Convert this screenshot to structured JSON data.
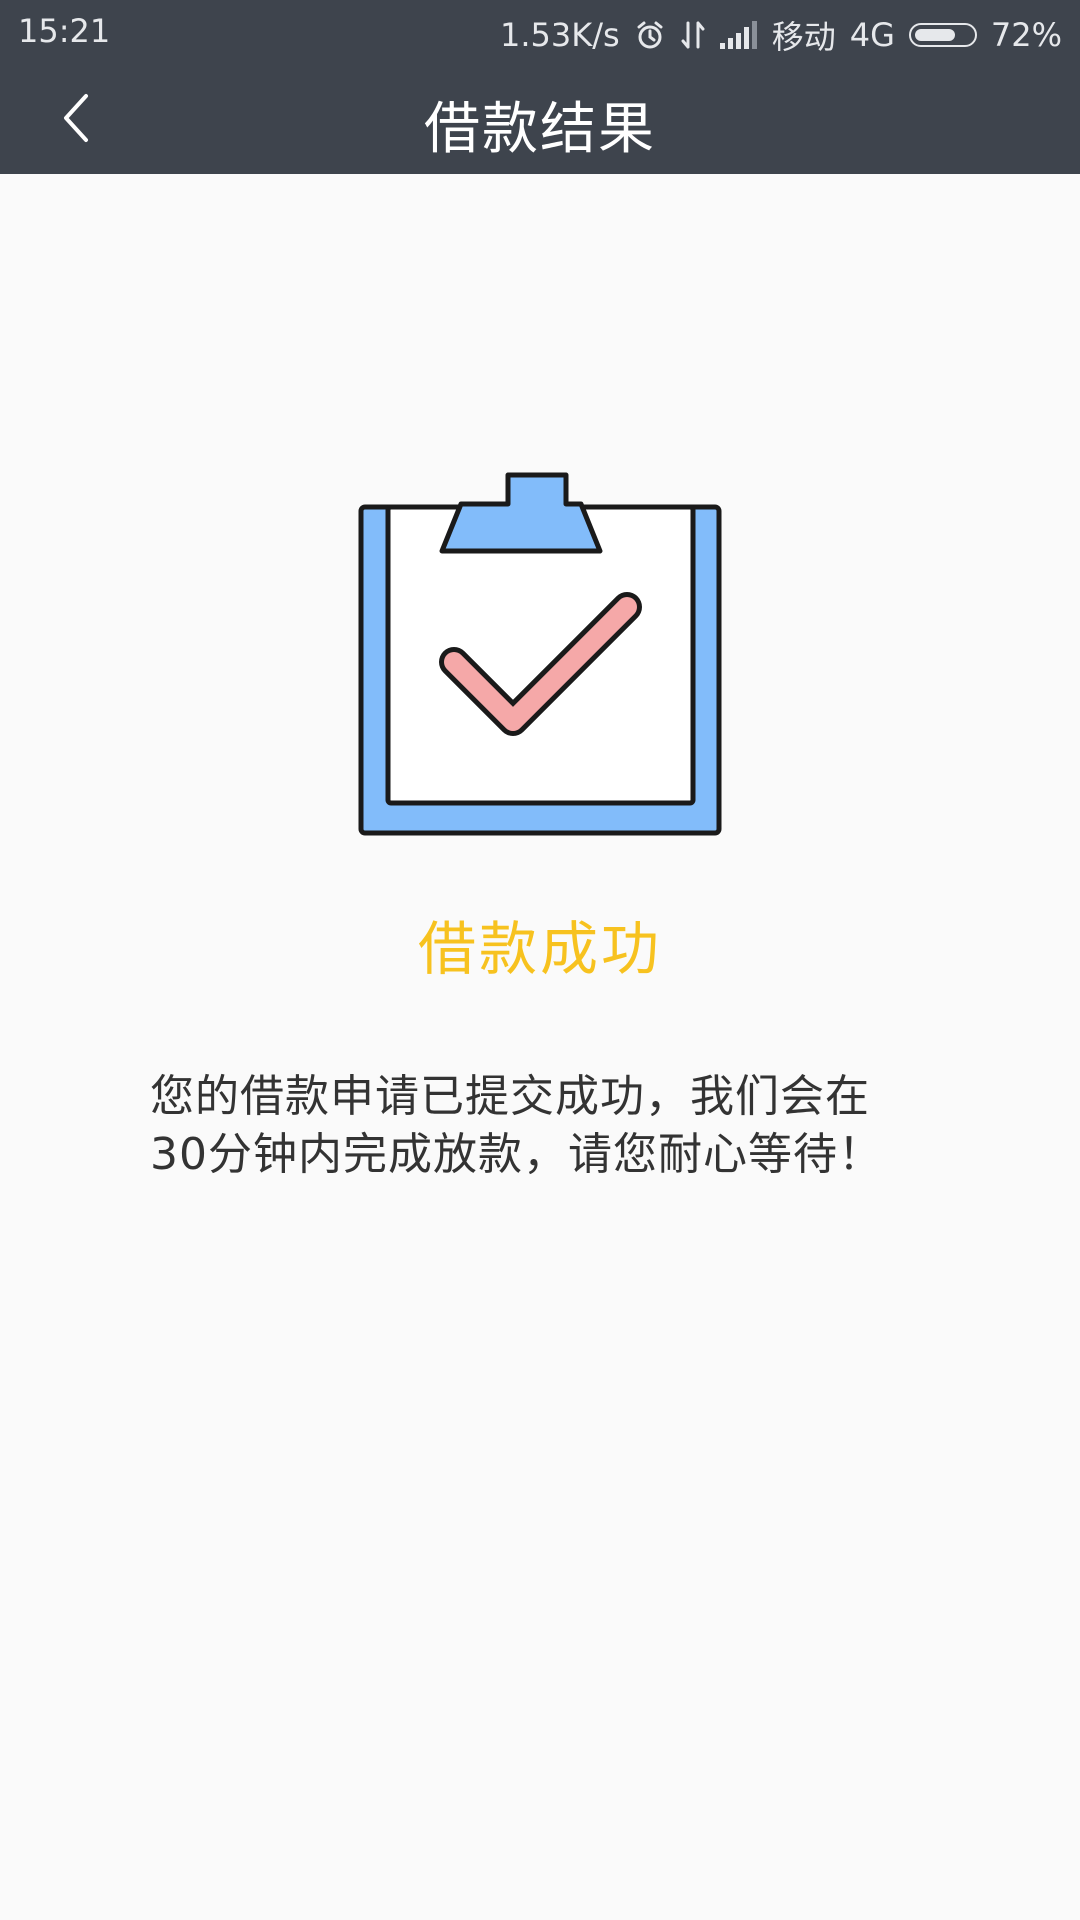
{
  "status_bar": {
    "time": "15:21",
    "network_speed": "1.53K/s",
    "carrier": "移动",
    "network_type": "4G",
    "battery": "72%",
    "battery_level": 0.72,
    "icons": [
      "alarm-icon",
      "data-transfer-icon",
      "signal-icon",
      "battery-icon"
    ]
  },
  "header": {
    "title": "借款结果",
    "back_icon": "chevron-left-icon"
  },
  "result": {
    "icon": "clipboard-check-icon",
    "title": "借款成功",
    "message": "您的借款申请已提交成功，我们会在30分钟内完成放款，请您耐心等待！"
  },
  "colors": {
    "header_bg": "#3e444d",
    "page_bg": "#fafafa",
    "success_title": "#f7c21f",
    "clipboard_blue": "#82bcfa",
    "check_pink": "#f5a8a8"
  }
}
